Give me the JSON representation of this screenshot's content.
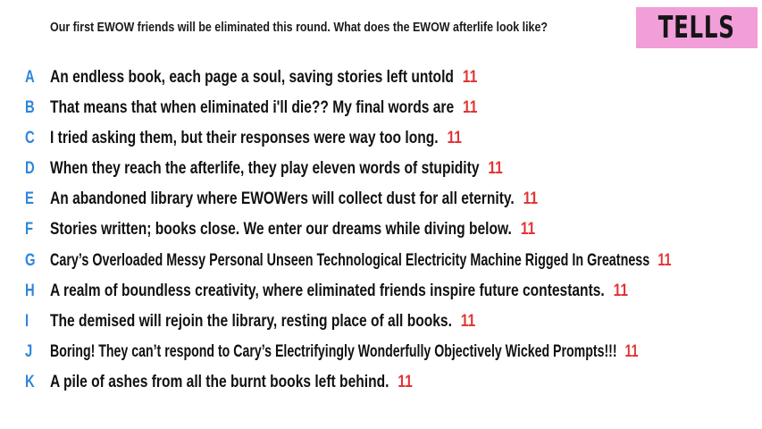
{
  "prompt": "Our first EWOW friends will be eliminated this round. What does the EWOW afterlife look like?",
  "badge": {
    "label": "TELLS",
    "color": "#f19ed9"
  },
  "colors": {
    "letter": "#2f86d9",
    "count": "#e33434",
    "text": "#111111"
  },
  "responses": [
    {
      "letter": "A",
      "text": "An endless book, each page a soul, saving stories left untold",
      "count": "11"
    },
    {
      "letter": "B",
      "text": "That means that when eliminated i'll die?? My final words are",
      "count": "11"
    },
    {
      "letter": "C",
      "text": "I tried asking them, but their responses were way too long.",
      "count": "11"
    },
    {
      "letter": "D",
      "text": "When they reach the afterlife, they play eleven words of stupidity",
      "count": "11"
    },
    {
      "letter": "E",
      "text": "An abandoned library where EWOWers will collect dust for all eternity.",
      "count": "11"
    },
    {
      "letter": "F",
      "text": "Stories written; books close. We enter our dreams while diving below.",
      "count": "11"
    },
    {
      "letter": "G",
      "text": "Cary’s Overloaded Messy Personal Unseen Technological Electricity Machine Rigged In Greatness",
      "count": "11"
    },
    {
      "letter": "H",
      "text": "A realm of boundless creativity, where eliminated friends inspire future contestants.",
      "count": "11"
    },
    {
      "letter": "I",
      "text": "The demised will rejoin the library, resting place of all books.",
      "count": "11"
    },
    {
      "letter": "J",
      "text": "Boring! They can’t respond to Cary’s Electrifyingly Wonderfully Objectively Wicked Prompts!!!",
      "count": "11"
    },
    {
      "letter": "K",
      "text": "A pile of ashes from all the burnt books left behind.",
      "count": "11"
    }
  ]
}
